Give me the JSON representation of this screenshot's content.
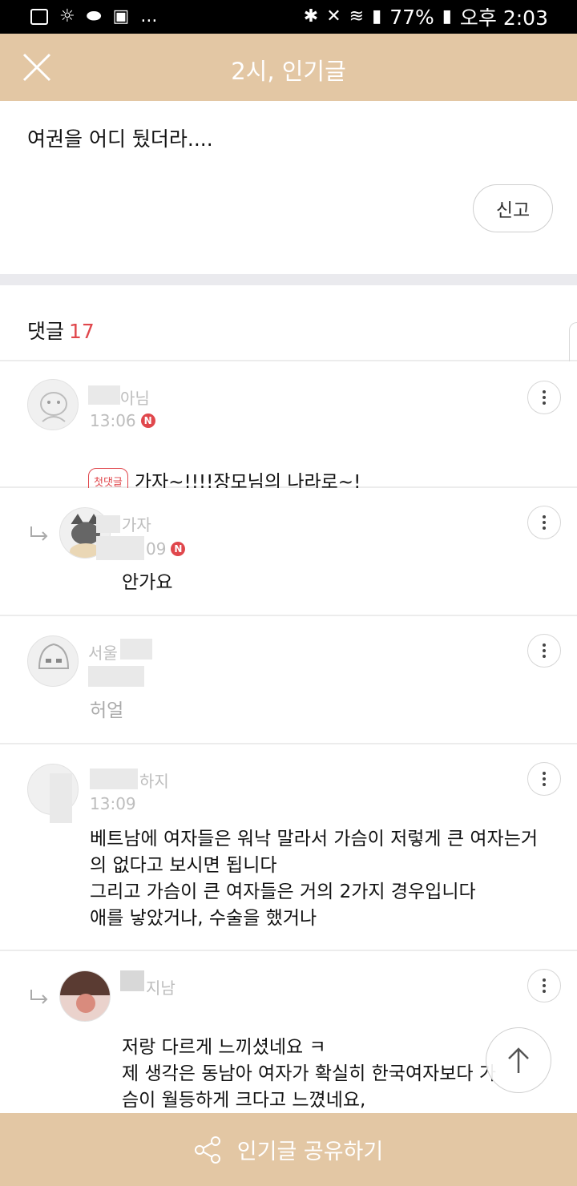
{
  "status_bar": {
    "battery": "77%",
    "time": "오후 2:03",
    "left_icons": [
      "app-icon",
      "weather-icon",
      "pill-icon",
      "image-icon",
      "more-dots"
    ],
    "ellipsis": "..."
  },
  "header": {
    "title": "2시, 인기글",
    "close_icon": "close-icon",
    "background": "#e3c7a4"
  },
  "post": {
    "body": "여권을 어디 뒀더라....",
    "report_label": "신고"
  },
  "comments_header": {
    "label": "댓글",
    "count": "17",
    "count_color": "#e0474c"
  },
  "comments": [
    {
      "nickname": "아님",
      "time": "13:06",
      "new_badge": "N",
      "first_badge": "첫댓글",
      "text": "가자~!!!!장모님의 나라로~!"
    },
    {
      "nickname": "가자",
      "time": "09",
      "new_badge": "N",
      "text": "안가요"
    },
    {
      "nickname": "서울",
      "time": "",
      "text": "허얼"
    },
    {
      "nickname": "하지",
      "time": "13:09",
      "text": "베트남에 여자들은 워낙 말라서 가슴이 저렇게 큰 여자는거의 없다고 보시면 됩니다\n그리고 가슴이 큰 여자들은 거의 2가지 경우입니다\n애를 낳았거나, 수술을 했거나"
    },
    {
      "nickname": "지남",
      "time": "",
      "text": "저랑 다르게 느끼셨네요 ㅋ\n제 생각은 동남아 여자가 확실히 한국여자보다 가\n슴이 월등하게 크다고 느꼈네요,"
    }
  ],
  "bottom_bar": {
    "label": "인기글 공유하기",
    "icon": "share-icon"
  }
}
